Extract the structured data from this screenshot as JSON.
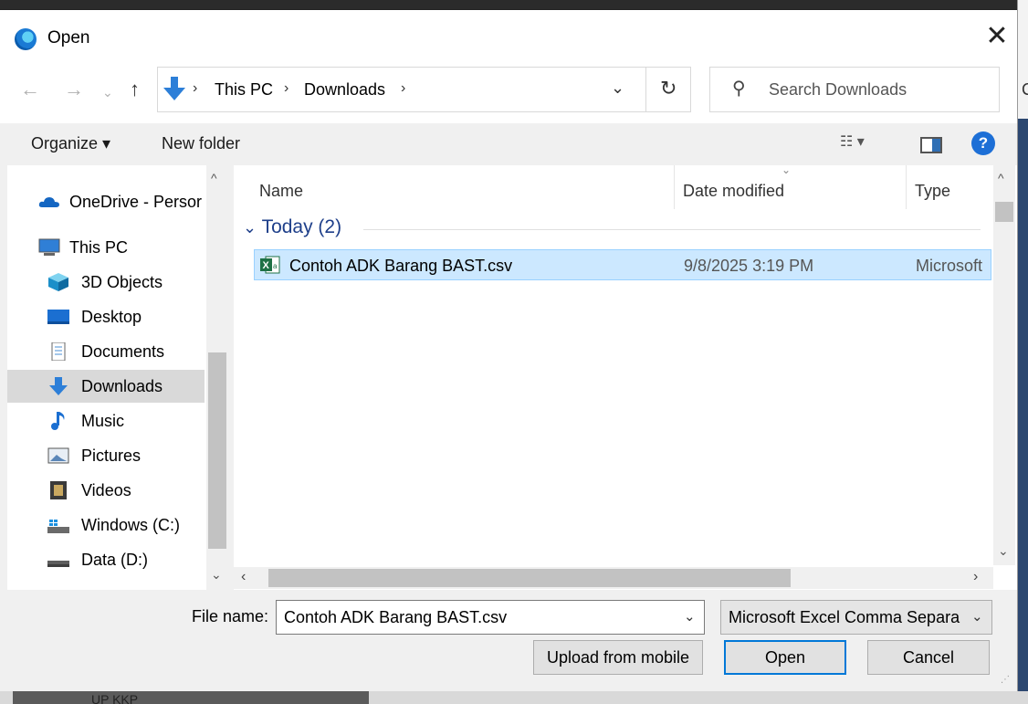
{
  "window": {
    "title": "Open",
    "close_glyph": "✕"
  },
  "nav": {
    "back_icon": "arrow-left-icon",
    "forward_icon": "arrow-right-icon",
    "recent_icon": "chevron-down-icon",
    "up_icon": "arrow-up-icon",
    "breadcrumb": [
      "This PC",
      "Downloads"
    ],
    "search_placeholder": "Search Downloads"
  },
  "toolbar": {
    "organize_label": "Organize ▾",
    "new_folder_label": "New folder",
    "help_label": "?"
  },
  "sidebar": {
    "items": [
      {
        "label": "OneDrive - Persor",
        "icon": "cloud-icon"
      },
      {
        "label": "This PC",
        "icon": "computer-icon"
      },
      {
        "label": "3D Objects",
        "icon": "cube-icon"
      },
      {
        "label": "Desktop",
        "icon": "desktop-icon"
      },
      {
        "label": "Documents",
        "icon": "document-icon"
      },
      {
        "label": "Downloads",
        "icon": "download-icon",
        "selected": true
      },
      {
        "label": "Music",
        "icon": "music-icon"
      },
      {
        "label": "Pictures",
        "icon": "pictures-icon"
      },
      {
        "label": "Videos",
        "icon": "video-icon"
      },
      {
        "label": "Windows (C:)",
        "icon": "drive-icon"
      },
      {
        "label": "Data (D:)",
        "icon": "drive-icon"
      }
    ]
  },
  "filelist": {
    "columns": [
      "Name",
      "Date modified",
      "Type"
    ],
    "group_header": "Today (2)",
    "files": [
      {
        "name": "Contoh ADK Barang BAST.csv",
        "date": "9/8/2025 3:19 PM",
        "type": "Microsoft",
        "icon": "excel-csv-icon",
        "selected": true
      }
    ]
  },
  "footer": {
    "filename_label": "File name:",
    "filename_value": "Contoh ADK Barang BAST.csv",
    "filetype_value": "Microsoft Excel Comma Separa",
    "upload_label": "Upload from mobile",
    "open_label": "Open",
    "cancel_label": "Cancel"
  },
  "background": {
    "app_text": "UP KKP"
  },
  "colors": {
    "accent": "#0078d7",
    "selection_bg": "#cce8ff",
    "group_header": "#1e3f8a"
  }
}
